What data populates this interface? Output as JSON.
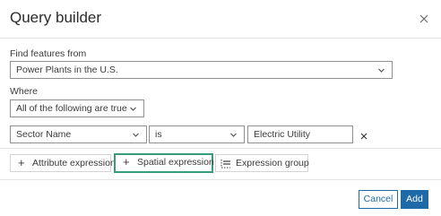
{
  "dialog": {
    "title": "Query builder"
  },
  "form": {
    "find_label": "Find features from",
    "layer_value": "Power Plants in the U.S.",
    "where_label": "Where",
    "match_value": "All of the following are true",
    "expression": {
      "field_value": "Sector Name",
      "operator_value": "is",
      "value": "Electric Utility"
    }
  },
  "toolbar": {
    "attribute_label": "Attribute expression",
    "spatial_label": "Spatial expression",
    "group_label": "Expression group"
  },
  "footer": {
    "cancel_label": "Cancel",
    "add_label": "Add"
  },
  "colors": {
    "accent_blue": "#1e6aa8",
    "highlight_green": "#3a9a7c"
  }
}
